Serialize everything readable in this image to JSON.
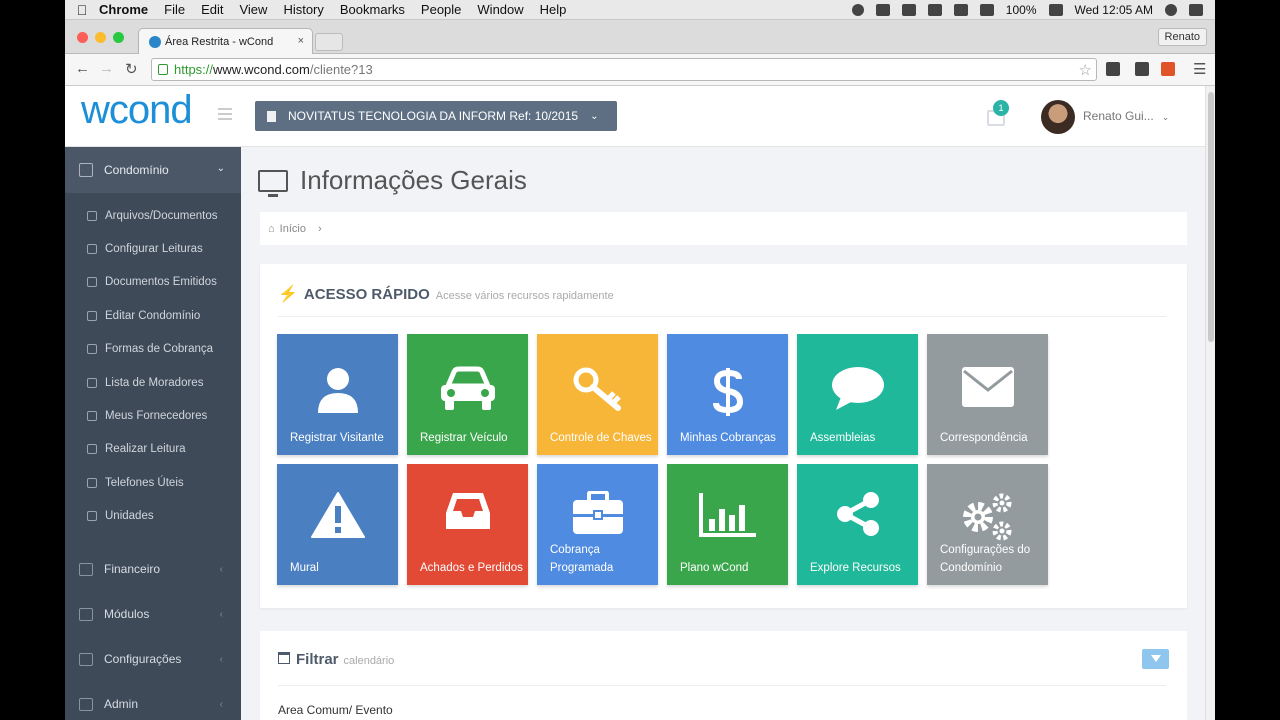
{
  "macos": {
    "app": "Chrome",
    "menus": [
      "File",
      "Edit",
      "View",
      "History",
      "Bookmarks",
      "People",
      "Window",
      "Help"
    ],
    "battery": "100%",
    "clock": "Wed 12:05 AM"
  },
  "browser": {
    "tab_title": "Área Restrita - wCond",
    "tab_close": "×",
    "profile": "Renato",
    "url_scheme": "https://",
    "url_host": "www.wcond.com",
    "url_path": "/cliente?13"
  },
  "header": {
    "logo": "wcond",
    "condo_selector": "NOVITATUS TECNOLOGIA DA INFORM Ref: 10/2015",
    "notification_count": "1",
    "user_name": "Renato Gui..."
  },
  "sidebar": {
    "section": "Condomínio",
    "sub_items": [
      {
        "label": "Arquivos/Documentos"
      },
      {
        "label": "Configurar Leituras"
      },
      {
        "label": "Documentos Emitidos"
      },
      {
        "label": "Editar Condomínio"
      },
      {
        "label": "Formas de Cobrança"
      },
      {
        "label": "Lista de Moradores"
      },
      {
        "label": "Meus Fornecedores"
      },
      {
        "label": "Realizar Leitura"
      },
      {
        "label": "Telefones Úteis"
      },
      {
        "label": "Unidades"
      }
    ],
    "main_items": [
      {
        "label": "Financeiro"
      },
      {
        "label": "Módulos"
      },
      {
        "label": "Configurações"
      },
      {
        "label": "Admin"
      }
    ]
  },
  "content": {
    "page_title": "Informações Gerais",
    "breadcrumb": "Início",
    "quick_access": {
      "title": "ACESSO RÁPIDO",
      "subtitle": "Acesse vários recursos rapidamente",
      "tiles": [
        {
          "label": "Registrar Visitante",
          "color": "#4a7fc1",
          "icon": "user-icon"
        },
        {
          "label": "Registrar Veículo",
          "color": "#3aa64b",
          "icon": "car-icon"
        },
        {
          "label": "Controle de Chaves",
          "color": "#f8b638",
          "icon": "key-icon"
        },
        {
          "label": "Minhas Cobranças",
          "color": "#4f8be0",
          "icon": "dollar-icon"
        },
        {
          "label": "Assembleias",
          "color": "#1fb89a",
          "icon": "speech-bubble-icon"
        },
        {
          "label": "Correspondência",
          "color": "#939b9f",
          "icon": "envelope-icon"
        },
        {
          "label": "Mural",
          "color": "#4a7fc1",
          "icon": "warning-icon"
        },
        {
          "label": "Achados e Perdidos",
          "color": "#e24a35",
          "icon": "inbox-icon"
        },
        {
          "label": "Cobrança Programada",
          "color": "#4f8be0",
          "icon": "briefcase-icon"
        },
        {
          "label": "Plano wCond",
          "color": "#3aa64b",
          "icon": "bar-chart-icon"
        },
        {
          "label": "Explore Recursos",
          "color": "#1fb89a",
          "icon": "share-icon"
        },
        {
          "label": "Configurações do Condomínio",
          "color": "#939b9f",
          "icon": "gears-icon"
        }
      ]
    },
    "filter": {
      "title": "Filtrar",
      "subtitle": "calendário",
      "field_label": "Area Comum/ Evento"
    }
  }
}
